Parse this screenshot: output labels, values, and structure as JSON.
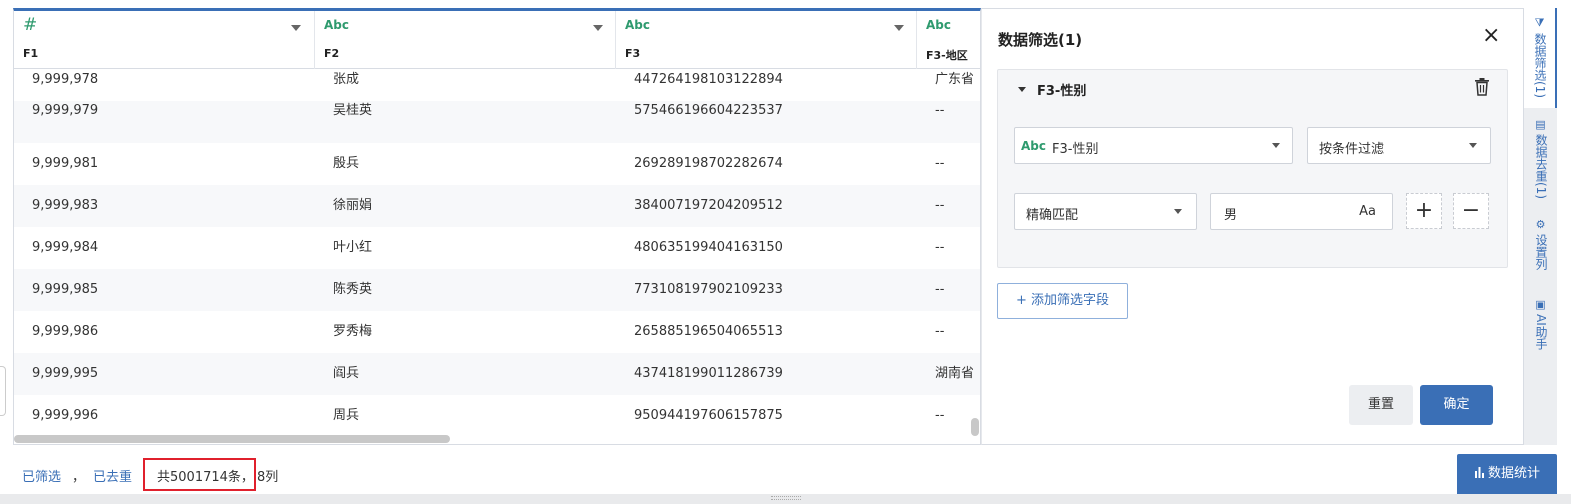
{
  "grid": {
    "columns": [
      {
        "type": "#",
        "name": "F1"
      },
      {
        "type": "Abc",
        "name": "F2"
      },
      {
        "type": "Abc",
        "name": "F3"
      },
      {
        "type": "Abc",
        "name": "F3-地区"
      }
    ],
    "rows": [
      {
        "f1": "9,999,978",
        "f2": "张成",
        "f3": "447264198103122894",
        "f4": "广东省"
      },
      {
        "f1": "9,999,979",
        "f2": "吴桂英",
        "f3": "575466196604223537",
        "f4": "--"
      },
      {
        "f1": "9,999,981",
        "f2": "殷兵",
        "f3": "269289198702282674",
        "f4": "--"
      },
      {
        "f1": "9,999,983",
        "f2": "徐丽娟",
        "f3": "384007197204209512",
        "f4": "--"
      },
      {
        "f1": "9,999,984",
        "f2": "叶小红",
        "f3": "480635199404163150",
        "f4": "--"
      },
      {
        "f1": "9,999,985",
        "f2": "陈秀英",
        "f3": "773108197902109233",
        "f4": "--"
      },
      {
        "f1": "9,999,986",
        "f2": "罗秀梅",
        "f3": "265885196504065513",
        "f4": "--"
      },
      {
        "f1": "9,999,995",
        "f2": "阎兵",
        "f3": "437418199011286739",
        "f4": "湖南省"
      },
      {
        "f1": "9,999,996",
        "f2": "周兵",
        "f3": "950944197606157875",
        "f4": "--"
      }
    ]
  },
  "filter_panel": {
    "title": "数据筛选(1)",
    "close_icon": "×",
    "condition": {
      "field_title": "F3-性别",
      "field_select_type": "Abc",
      "field_select_value": "F3-性别",
      "mode_select_value": "按条件过滤",
      "match_select_value": "精确匹配",
      "value_input": "男",
      "case_toggle": "Aa",
      "add_icon": "+",
      "remove_icon": "−"
    },
    "add_field_label": "+ 添加筛选字段",
    "reset_label": "重置",
    "confirm_label": "确定"
  },
  "side_tabs": [
    {
      "icon": "filter-icon",
      "glyph": "⧩",
      "label": "数据筛选(1)"
    },
    {
      "icon": "dedupe-icon",
      "glyph": "▤",
      "label": "数据去重(1)"
    },
    {
      "icon": "gear-icon",
      "glyph": "⚙",
      "label": "设置列"
    },
    {
      "icon": "robot-icon",
      "glyph": "▣",
      "label": "AI助手"
    }
  ],
  "footer": {
    "filtered_link": "已筛选",
    "separator": "，",
    "dedup_link": "已去重",
    "count_text": "共5001714条，",
    "columns_text": "8列",
    "stats_button": "数据统计",
    "stats_icon": "bar-chart-icon"
  },
  "colors": {
    "accent": "#3a6fb6",
    "type_green": "#2e9a6e",
    "highlight_red": "#e0202c"
  }
}
